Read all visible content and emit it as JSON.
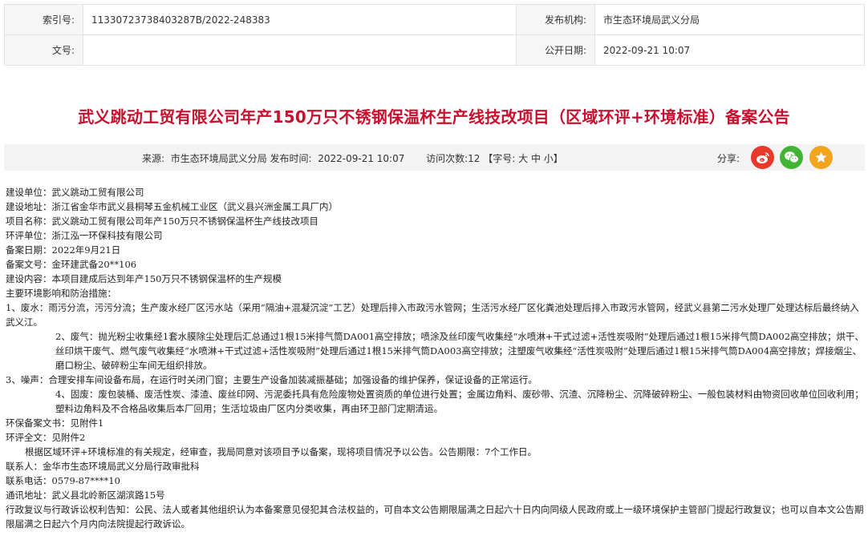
{
  "meta": {
    "index_label": "索引号:",
    "index_value": "11330723738403287B/2022-248383",
    "publisher_label": "发布机构:",
    "publisher_value": "市生态环境局武义分局",
    "docno_label": "文号:",
    "docno_value": "",
    "pubdate_label": "公开日期:",
    "pubdate_value": "2022-09-21 10:07"
  },
  "title": "武义跳动工贸有限公司年产150万只不锈钢保温杯生产线技改项目（区域环评+环境标准）备案公告",
  "infobar": {
    "source_label": "来源:",
    "source_value": "市生态环境局武义分局",
    "time_label": "发布时间:",
    "time_value": "2022-09-21 10:07",
    "visits_label": "访问次数:",
    "visits_value": "12",
    "font_label": "【字号:",
    "font_large": "大",
    "font_medium": "中",
    "font_small": "小",
    "font_end": "】",
    "share_label": "分享:"
  },
  "colors": {
    "title": "#c8102e",
    "weibo": "#e8392b",
    "wechat": "#42b435",
    "favorite": "#f0a51d"
  },
  "icons": [
    "weibo-icon",
    "wechat-icon",
    "star-icon"
  ],
  "content": {
    "l1": "建设单位：武义跳动工贸有限公司",
    "l2": "建设地址：浙江省金华市武义县桐琴五金机械工业区（武义县兴洲金属工具厂内）",
    "l3": "项目名称：武义跳动工贸有限公司年产150万只不锈钢保温杯生产线技改项目",
    "l4": "环评单位：浙江泓一环保科技有限公司",
    "l5": "备案日期：2022年9月21日",
    "l6": "备案文号：金环建武备20**106",
    "l7": "建设内容：本项目建成后达到年产150万只不锈钢保温杯的生产规模",
    "l8": "主要环境影响和防治措施：",
    "l9": "1、废水：雨污分流，污污分流；生产废水经厂区污水站（采用“隔油+混凝沉淀”工艺）处理后排入市政污水管网；生活污水经厂区化粪池处理后排入市政污水管网，经武义县第二污水处理厂处理达标后最终纳入武义江。",
    "l10": "2、废气：抛光粉尘收集经1套水膜除尘处理后汇总通过1根15米排气筒DA001高空排放；喷涂及丝印废气收集经“水喷淋+干式过滤+活性炭吸附”处理后通过1根15米排气筒DA002高空排放；烘干、丝印烘干废气、燃气废气收集经“水喷淋+干式过滤+活性炭吸附”处理后通过1根15米排气筒DA003高空排放；注塑废气收集经“活性炭吸附”处理后通过1根15米排气筒DA004高空排放；焊接烟尘、磨口粉尘、破碎粉尘车间无组织排放。",
    "l11": "3、噪声：合理安排车间设备布局，在运行时关闭门窗；主要生产设备加装减振基础；加强设备的维护保养，保证设备的正常运行。",
    "l12": "4、固废：废包装桶、废活性炭、漆渣、废丝印网、污泥委托具有危险废物处置资质的单位进行处置；金属边角料、废砂带、沉渣、沉降粉尘、沉降破碎粉尘、一般包装材料由物资回收单位回收利用；塑料边角料及不合格品收集后本厂回用；生活垃圾由厂区内分类收集，再由环卫部门定期清运。",
    "l13": "环保备案文书：见附件1",
    "l14": "环评全文：见附件2",
    "l15": "根据区域环评+环境标准的有关规定，经审查，我局同意对该项目予以备案，现将项目情况予以公告。公告期限：7个工作日。",
    "l16": "联系人：金华市生态环境局武义分局行政审批科",
    "l17": "联系电话：0579-87****10",
    "l18": "通讯地址：武义县北岭新区湖滨路15号",
    "l19": "行政复议与行政诉讼权利告知：公民、法人或者其他组织认为本备案意见侵犯其合法权益的，可自本文公告期限届满之日起六十日内向同级人民政府或上一级环境保护主管部门提起行政复议；也可以自本文公告期限届满之日起六个月内向法院提起行政诉讼。"
  }
}
